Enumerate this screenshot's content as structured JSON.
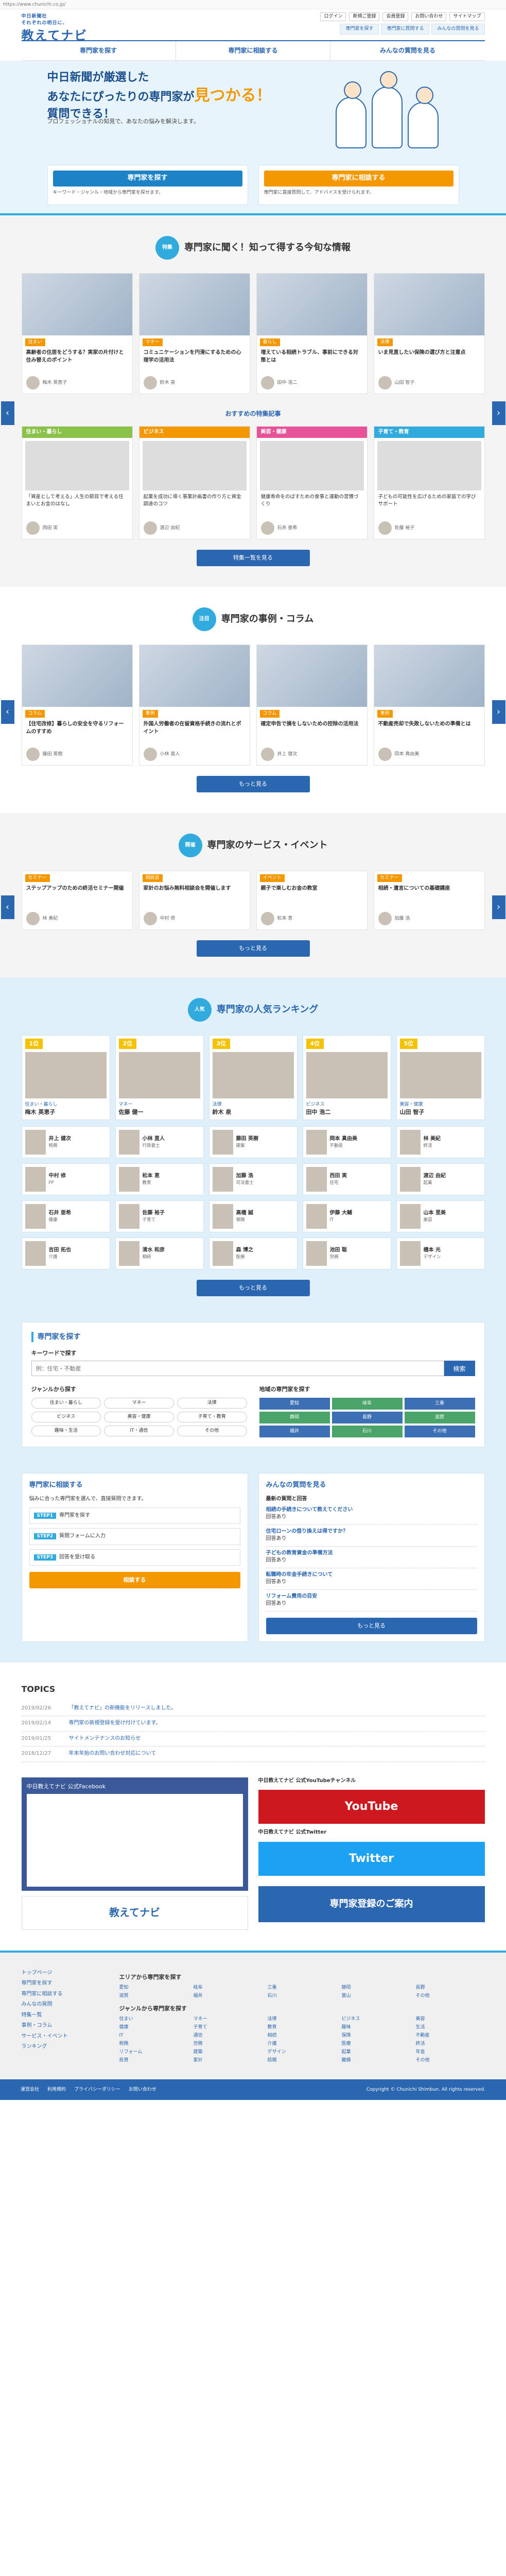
{
  "browser": {
    "url": "https://www.chunichi.co.jp/"
  },
  "header": {
    "logo_top": "中日新聞社",
    "logo_tagline": "それぞれの明日に、",
    "logo_main": "教えてナビ",
    "topmenu": [
      "ログイン",
      "新規ご登録",
      "会員登録",
      "お問い合わせ",
      "サイトマップ"
    ],
    "gnav": [
      "専門家を探す",
      "専門家に質問する",
      "みんなの質問を見る"
    ]
  },
  "mainnav": [
    "専門家を探す",
    "専門家に相談する",
    "みんなの質問を見る"
  ],
  "hero": {
    "line1": "中日新聞が厳選した",
    "line2": "あなたにぴったりの専門家が",
    "highlight": "見つかる！",
    "line3": "質問できる！",
    "sub": "プロフェッショナルの知見で、あなたの悩みを解決します。",
    "btn1": "専門家を探す",
    "btn1_desc": "キーワード・ジャンル・地域から専門家を探せます。",
    "btn2": "専門家に相談する",
    "btn2_desc": "専門家に直接質問して、アドバイスを受けられます。"
  },
  "sec1": {
    "badge": "特集",
    "title": "専門家に聞く！知って得する今旬な情報",
    "cards": [
      {
        "tag": "住まい",
        "title": "高齢者の住居をどうする？実家の片付けと住み替えのポイント",
        "author": "梅木 英恵子"
      },
      {
        "tag": "マネー",
        "title": "コミュニケーションを円滑にするための心理学の活用法",
        "author": "鈴木 泉"
      },
      {
        "tag": "暮らし",
        "title": "増えている相続トラブル、事前にできる対策とは",
        "author": "田中 浩二"
      },
      {
        "tag": "法律",
        "title": "いま見直したい保険の選び方と注意点",
        "author": "山田 智子"
      }
    ],
    "subhead": "おすすめの特集記事",
    "cats": [
      {
        "name": "住まい・暮らし",
        "text": "「資産として考える」人生の節目で考える住まいとお金のはなし",
        "author": "西田 実"
      },
      {
        "name": "ビジネス",
        "text": "起業を成功に導く事業計画書の作り方と資金調達のコツ",
        "author": "渡辺 由紀"
      },
      {
        "name": "美容・健康",
        "text": "健康寿命をのばすための食事と運動の習慣づくり",
        "author": "石井 亜希"
      },
      {
        "name": "子育て・教育",
        "text": "子どもの可能性を広げるための家庭での学びサポート",
        "author": "佐藤 裕子"
      }
    ],
    "more": "特集一覧を見る"
  },
  "sec2": {
    "badge": "注目",
    "title": "専門家の事例・コラム",
    "cards": [
      {
        "tag": "コラム",
        "title": "【住宅改修】暮らしの安全を守るリフォームのすすめ",
        "author": "藤田 英樹"
      },
      {
        "tag": "事例",
        "title": "外国人労働者の在留資格手続きの流れとポイント",
        "author": "小林 直人"
      },
      {
        "tag": "コラム",
        "title": "確定申告で損をしないための控除の活用法",
        "author": "井上 健次"
      },
      {
        "tag": "事例",
        "title": "不動産売却で失敗しないための準備とは",
        "author": "岡本 真由美"
      }
    ],
    "more": "もっと見る"
  },
  "sec3": {
    "badge": "開催",
    "title": "専門家のサービス・イベント",
    "cards": [
      {
        "tag": "セミナー",
        "title": "ステップアップのための終活セミナー開催",
        "author": "林 美紀"
      },
      {
        "tag": "相談会",
        "title": "家計のお悩み無料相談会を開催します",
        "author": "中村 修"
      },
      {
        "tag": "イベント",
        "title": "親子で楽しむお金の教室",
        "author": "松本 恵"
      },
      {
        "tag": "セミナー",
        "title": "相続・遺言についての基礎講座",
        "author": "加藤 浩"
      }
    ],
    "more": "もっと見る"
  },
  "ranking": {
    "badge": "人気",
    "title": "専門家の人気ランキング",
    "top": [
      {
        "rank": "1位",
        "tag": "住まい・暮らし",
        "name": "梅木 英恵子"
      },
      {
        "rank": "2位",
        "tag": "マネー",
        "name": "佐藤 健一"
      },
      {
        "rank": "3位",
        "tag": "法律",
        "name": "鈴木 泉"
      },
      {
        "rank": "4位",
        "tag": "ビジネス",
        "name": "田中 浩二"
      },
      {
        "rank": "5位",
        "tag": "美容・健康",
        "name": "山田 智子"
      }
    ],
    "rest": [
      {
        "name": "井上 健次",
        "tag": "税務"
      },
      {
        "name": "小林 直人",
        "tag": "行政書士"
      },
      {
        "name": "藤田 英樹",
        "tag": "建築"
      },
      {
        "name": "岡本 真由美",
        "tag": "不動産"
      },
      {
        "name": "林 美紀",
        "tag": "終活"
      },
      {
        "name": "中村 修",
        "tag": "FP"
      },
      {
        "name": "松本 恵",
        "tag": "教育"
      },
      {
        "name": "加藤 浩",
        "tag": "司法書士"
      },
      {
        "name": "西田 実",
        "tag": "住宅"
      },
      {
        "name": "渡辺 由紀",
        "tag": "起業"
      },
      {
        "name": "石井 亜希",
        "tag": "健康"
      },
      {
        "name": "佐藤 裕子",
        "tag": "子育て"
      },
      {
        "name": "高橋 誠",
        "tag": "保険"
      },
      {
        "name": "伊藤 大輔",
        "tag": "IT"
      },
      {
        "name": "山本 里美",
        "tag": "美容"
      },
      {
        "name": "吉田 拓也",
        "tag": "介護"
      },
      {
        "name": "清水 和彦",
        "tag": "相続"
      },
      {
        "name": "森 博之",
        "tag": "医療"
      },
      {
        "name": "池田 聡",
        "tag": "労務"
      },
      {
        "name": "橋本 光",
        "tag": "デザイン"
      }
    ],
    "more": "もっと見る"
  },
  "search": {
    "title": "専門家を探す",
    "kw_label": "キーワードで探す",
    "placeholder": "例：住宅・不動産",
    "btn": "検索",
    "genre_label": "ジャンルから探す",
    "genres": [
      "住まい・暮らし",
      "マネー",
      "法律",
      "ビジネス",
      "美容・健康",
      "子育て・教育",
      "趣味・生活",
      "IT・通信",
      "その他"
    ],
    "area_label": "地域の専門家を探す",
    "areas": [
      "愛知",
      "岐阜",
      "三重",
      "静岡",
      "長野",
      "滋賀",
      "福井",
      "石川",
      "その他"
    ]
  },
  "ask": {
    "title": "専門家に相談する",
    "desc": "悩みに合った専門家を選んで、直接質問できます。",
    "steps": [
      {
        "n": "STEP1",
        "t": "専門家を探す"
      },
      {
        "n": "STEP2",
        "t": "質問フォームに入力"
      },
      {
        "n": "STEP3",
        "t": "回答を受け取る"
      }
    ],
    "btn": "相談する",
    "qa_title": "みんなの質問を見る",
    "qa_sub": "最新の質問と回答",
    "qas": [
      {
        "q": "相続の手続きについて教えてください",
        "a": "回答あり"
      },
      {
        "q": "住宅ローンの借り換えは得ですか？",
        "a": "回答あり"
      },
      {
        "q": "子どもの教育資金の準備方法",
        "a": "回答あり"
      },
      {
        "q": "転職時の年金手続きについて",
        "a": "回答あり"
      },
      {
        "q": "リフォーム費用の目安",
        "a": "回答あり"
      }
    ],
    "more": "もっと見る"
  },
  "topics": {
    "title": "TOPICS",
    "items": [
      {
        "date": "2019/02/26",
        "text": "「教えてナビ」の新機能をリリースしました。"
      },
      {
        "date": "2019/02/14",
        "text": "専門家の新規登録を受け付けています。"
      },
      {
        "date": "2019/01/25",
        "text": "サイトメンテナンスのお知らせ"
      },
      {
        "date": "2018/12/27",
        "text": "年末年始のお問い合わせ対応について"
      }
    ]
  },
  "banners": {
    "fb": "中日教えてナビ 公式Facebook",
    "yt": "YouTube",
    "yt_label": "中日教えてナビ 公式YouTubeチャンネル",
    "tw": "Twitter",
    "tw_label": "中日教えてナビ 公式Twitter",
    "logo": "教えてナビ",
    "reg": "専門家登録のご案内"
  },
  "footer": {
    "side": [
      "トップページ",
      "専門家を探す",
      "専門家に相談する",
      "みんなの質問",
      "特集一覧",
      "事例・コラム",
      "サービス・イベント",
      "ランキング"
    ],
    "area_title": "エリアから専門家を探す",
    "area_links": [
      "愛知",
      "岐阜",
      "三重",
      "静岡",
      "長野",
      "滋賀",
      "福井",
      "石川",
      "富山",
      "その他"
    ],
    "genre_title": "ジャンルから専門家を探す",
    "genre_links": [
      "住まい",
      "マネー",
      "法律",
      "ビジネス",
      "美容",
      "健康",
      "子育て",
      "教育",
      "趣味",
      "生活",
      "IT",
      "通信",
      "相続",
      "保険",
      "不動産",
      "税務",
      "労務",
      "介護",
      "医療",
      "終活",
      "リフォーム",
      "建築",
      "デザイン",
      "起業",
      "年金",
      "投資",
      "家計",
      "結婚",
      "離婚",
      "その他"
    ],
    "bottom_links": [
      "運営会社",
      "利用規約",
      "プライバシーポリシー",
      "お問い合わせ"
    ],
    "copyright": "Copyright © Chunichi Shimbun. All rights reserved."
  }
}
